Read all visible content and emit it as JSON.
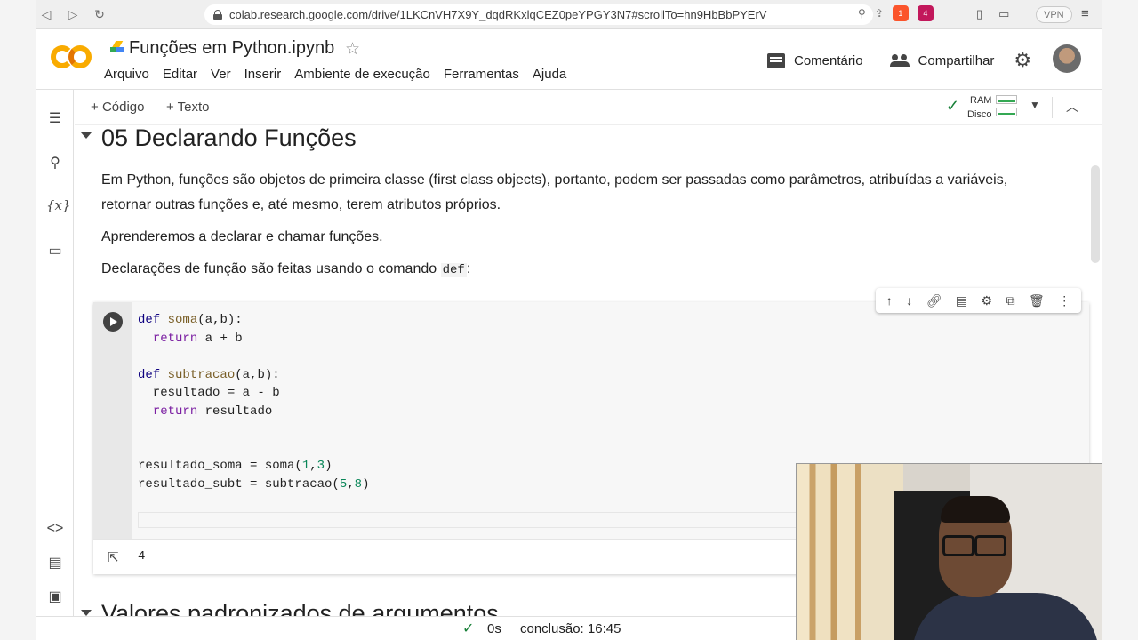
{
  "browser": {
    "url": "colab.research.google.com/drive/1LKCnVH7X9Y_dqdRKxlqCEZ0peYPGY3N7#scrollTo=hn9HbBbPYErV",
    "vpn_label": "VPN",
    "brave_badge": "1",
    "ext_badge": "4"
  },
  "header": {
    "title": "Funções em Python.ipynb",
    "menus": [
      "Arquivo",
      "Editar",
      "Ver",
      "Inserir",
      "Ambiente de execução",
      "Ferramentas",
      "Ajuda"
    ],
    "comment_label": "Comentário",
    "share_label": "Compartilhar"
  },
  "toolbar": {
    "add_code": "Código",
    "add_text": "Texto",
    "ram_label": "RAM",
    "disk_label": "Disco"
  },
  "notebook": {
    "section_title": "05 Declarando Funções",
    "paragraph1": "Em Python, funções são objetos de primeira classe (first class objects), portanto, podem ser passadas como parâmetros, atribuídas a variáveis, retornar outras funções e, até mesmo, terem atributos próprios.",
    "paragraph2": "Aprenderemos a declarar e chamar funções.",
    "paragraph3_prefix": "Declarações de função são feitas usando o comando",
    "paragraph3_code": "def",
    "paragraph3_suffix": ":",
    "output_value": "4",
    "next_section_title": "Valores padronizados de argumentos"
  },
  "status": {
    "elapsed": "0s",
    "completion": "conclusão: 16:45"
  },
  "colors": {
    "colab_orange": "#f9ab00",
    "ok_green": "#188038",
    "keyword": "#0d0080",
    "function": "#795e26",
    "number": "#098658"
  },
  "icons": {
    "toc": "list-icon",
    "search": "search-icon",
    "variables": "variables-icon",
    "files": "folder-icon",
    "snippets": "code-icon",
    "command_palette": "keyboard-icon",
    "terminal": "terminal-icon"
  }
}
